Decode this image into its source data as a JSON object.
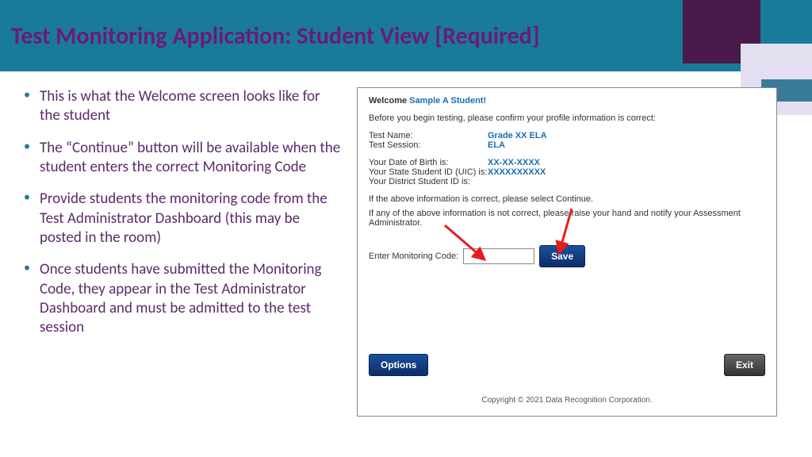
{
  "slide": {
    "title": "Test Monitoring Application: Student View [Required]"
  },
  "bullets": [
    "This is what the Welcome screen looks like for the student",
    "The “Continue” button will be available when the student enters the correct Monitoring Code",
    "Provide students the monitoring code from the Test Administrator Dashboard (this may be posted in the room)",
    "Once students have submitted the Monitoring Code, they appear in the Test Administrator Dashboard and must be admitted to the test session"
  ],
  "app": {
    "welcome_prefix": "Welcome ",
    "student_name": "Sample A Student!",
    "intro": "Before you begin testing, please confirm your profile information is correct:",
    "rows": {
      "test_name_label": "Test Name:",
      "test_name_value": "Grade XX ELA",
      "test_session_label": "Test Session:",
      "test_session_value": "ELA",
      "dob_label": "Your Date of Birth is:",
      "dob_value": "XX-XX-XXXX",
      "uic_label": "Your State Student ID (UIC) is:",
      "uic_value": "XXXXXXXXXX",
      "district_label": "Your District Student ID is:",
      "district_value": ""
    },
    "instr1": "If the above information is correct, please select Continue.",
    "instr2": "If any of the above information is not correct, please raise your hand and notify your Assessment Administrator.",
    "code_label": "Enter Monitoring Code:",
    "save_btn": "Save",
    "options_btn": "Options",
    "exit_btn": "Exit",
    "copyright": "Copyright © 2021 Data Recognition Corporation."
  }
}
